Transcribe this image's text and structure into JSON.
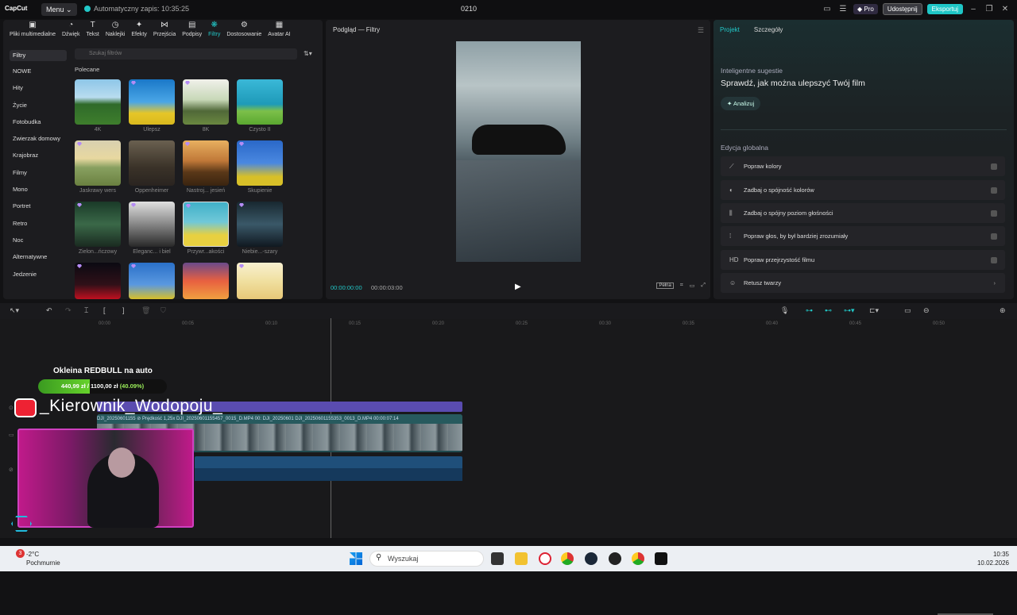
{
  "titlebar": {
    "logo": "CapCut",
    "menu": "Menu ⌄",
    "autosave": "Automatyczny zapis: 10:35:25",
    "project": "0210",
    "pro": "◆ Pro",
    "share": "Udostępnij",
    "export": "Eksportuj"
  },
  "tools": [
    "Pliki multimedialne",
    "Dźwięk",
    "Tekst",
    "Naklejki",
    "Efekty",
    "Przejścia",
    "Podpisy",
    "Filtry",
    "Dostosowanie",
    "Avatar AI"
  ],
  "categories": {
    "selected": "Filtry",
    "items": [
      "NOWE",
      "Hity",
      "Życie",
      "Fotobudka",
      "Zwierzak domowy",
      "Krajobraz",
      "Filmy",
      "Mono",
      "Portret",
      "Retro",
      "Noc",
      "Alternatywne",
      "Jedzenie"
    ]
  },
  "search": {
    "placeholder": "Szukaj filtrów"
  },
  "section": "Polecane",
  "filters": [
    "4K",
    "Ulepsz",
    "8K",
    "Czysto II",
    "Jaskrawy wers",
    "Oppenheimer",
    "Nastroj... jesień",
    "Skupienie",
    "Zielon...ńczowy",
    "Eleganc... i biel",
    "Przywr...akości",
    "Niebie...-szary",
    "",
    "",
    "",
    ""
  ],
  "preview": {
    "title": "Podgląd — Filtry",
    "current_time": "00:00:00:00",
    "total_time": "00:00:03:00",
    "full": "Pełna"
  },
  "right": {
    "tabs": [
      "Projekt",
      "Szczegóły"
    ],
    "suggest_head": "Inteligentne sugestie",
    "suggest_title": "Sprawdź, jak można ulepszyć Twój film",
    "analyze": "Analizuj",
    "global_head": "Edycja globalna",
    "options": [
      "Popraw kolory",
      "Zadbaj o spójność kolorów",
      "Zadbaj o spójny poziom głośności",
      "Popraw głos, by był bardziej zrozumiały",
      "Popraw przejrzystość filmu",
      "Retusz twarzy"
    ]
  },
  "ruler": [
    "00:00",
    "00:05",
    "00:10",
    "00:15",
    "00:20",
    "00:25",
    "00:30",
    "00:35",
    "00:40",
    "00:45",
    "00:50"
  ],
  "clip": {
    "head": "DJI_20250601155  ⊘ Prędkość 1,25x  DJI_20250601155457_0015_D.MP4  00:  DJI_20250601  DJI_20250601155353_0013_D.MP4  00:00:07:14"
  },
  "overlay": {
    "title": "Okleina REDBULL na auto",
    "progress": 0.4009,
    "progress_text": "440,99 zł / 1100,00 zł ",
    "progress_pct": "(40.09%)",
    "handle": "_Kierownik_Wodopoju_"
  },
  "taskbar": {
    "badge": "3",
    "temp": "-2°C",
    "cond": "Pochmurnie",
    "search": "Wyszukaj",
    "time": "10:35",
    "date": "10.02.2026"
  }
}
